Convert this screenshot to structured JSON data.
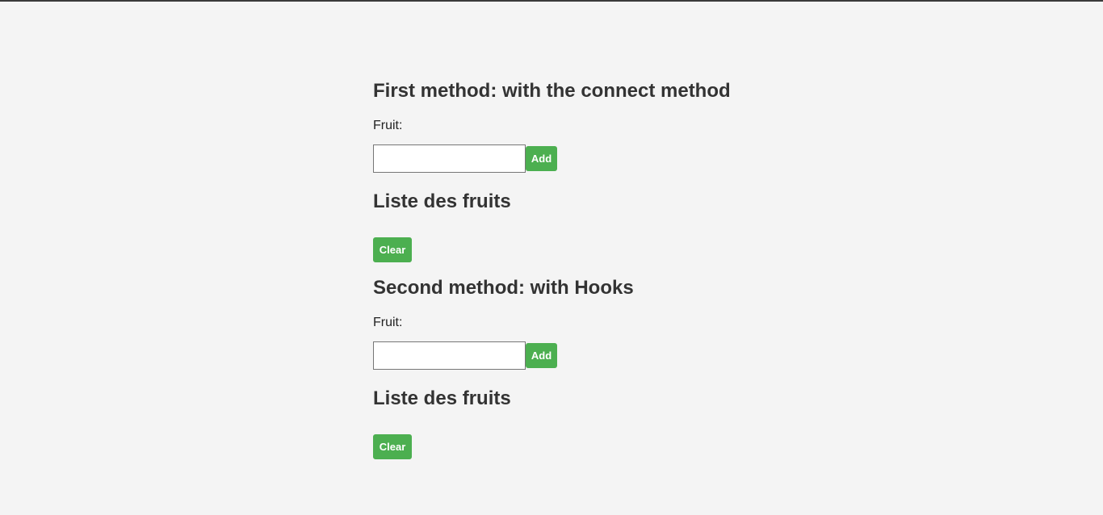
{
  "sections": [
    {
      "title": "First method: with the connect method",
      "fruit_label": "Fruit:",
      "fruit_input_value": "",
      "add_label": "Add",
      "list_title": "Liste des fruits",
      "clear_label": "Clear"
    },
    {
      "title": "Second method: with Hooks",
      "fruit_label": "Fruit:",
      "fruit_input_value": "",
      "add_label": "Add",
      "list_title": "Liste des fruits",
      "clear_label": "Clear"
    }
  ],
  "colors": {
    "background": "#f4f4f4",
    "button": "#4caf50",
    "button_text": "#ffffff",
    "heading": "#333333"
  }
}
